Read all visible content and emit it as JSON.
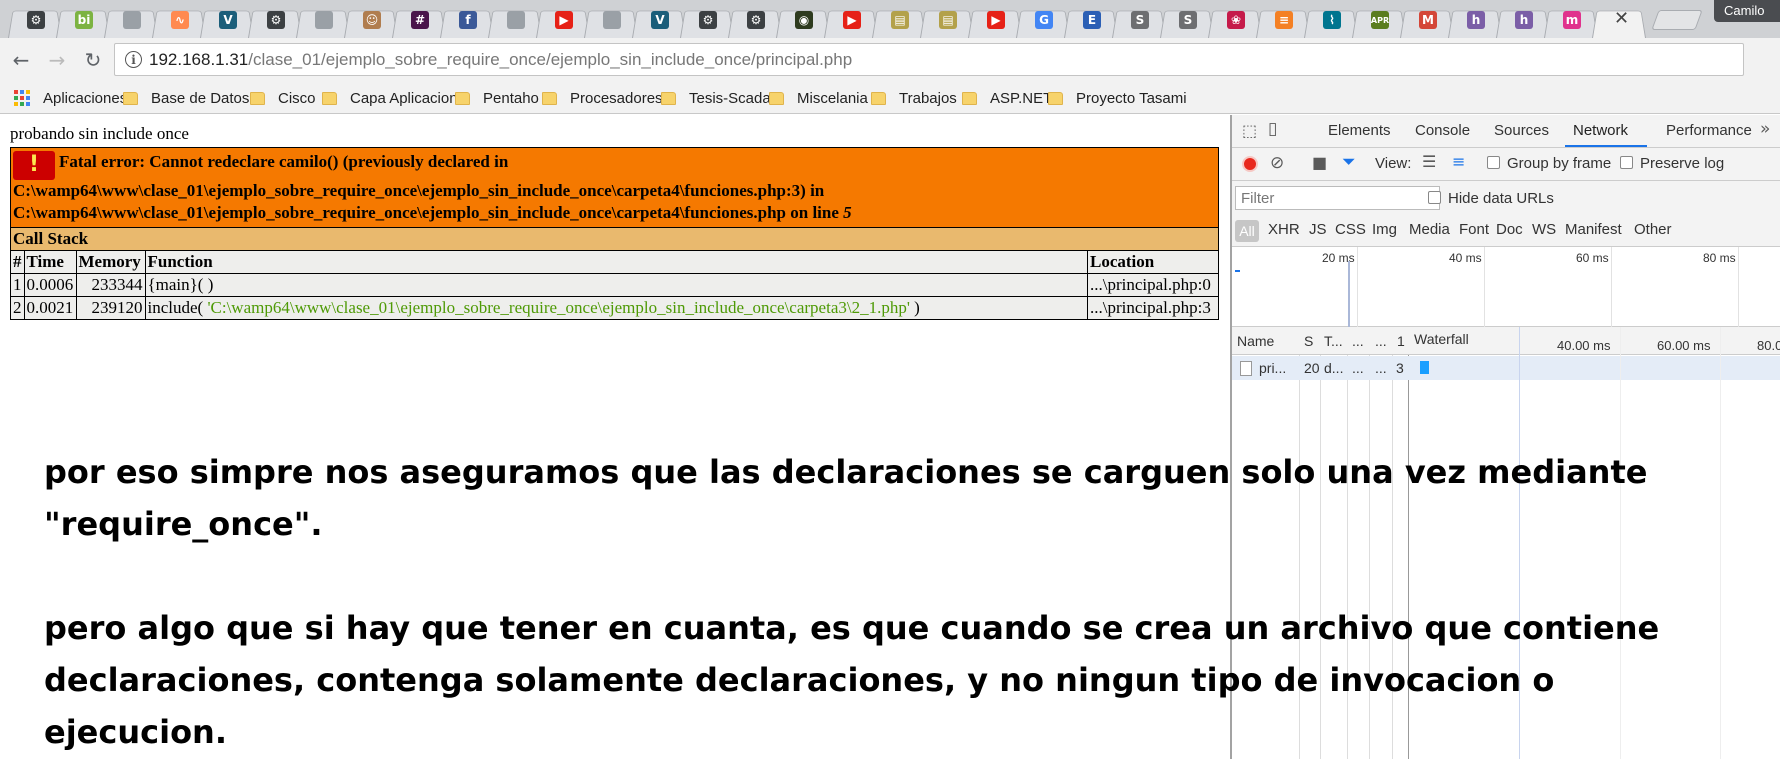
{
  "browser": {
    "tabs": [
      {
        "icon": "gear-icon",
        "color": "#3c4043",
        "glyph": "⚙"
      },
      {
        "icon": "bi-logo-icon",
        "color": "#7cb342",
        "glyph": "bi"
      },
      {
        "icon": "page-icon",
        "color": "#9aa0a6",
        "glyph": ""
      },
      {
        "icon": "wave-logo-icon",
        "color": "#ff8a50",
        "glyph": "∿"
      },
      {
        "icon": "v-logo-icon",
        "color": "#1b5e7a",
        "glyph": "V"
      },
      {
        "icon": "gear-icon",
        "color": "#3c4043",
        "glyph": "⚙"
      },
      {
        "icon": "page-icon",
        "color": "#9aa0a6",
        "glyph": ""
      },
      {
        "icon": "face-avatar-icon",
        "color": "#b07d4f",
        "glyph": "☺"
      },
      {
        "icon": "slack-icon",
        "color": "#4a154b",
        "glyph": "#"
      },
      {
        "icon": "facebook-icon",
        "color": "#3b5998",
        "glyph": "f"
      },
      {
        "icon": "page-icon",
        "color": "#9aa0a6",
        "glyph": ""
      },
      {
        "icon": "youtube-icon",
        "color": "#e62117",
        "glyph": "▶"
      },
      {
        "icon": "page-icon",
        "color": "#9aa0a6",
        "glyph": ""
      },
      {
        "icon": "v-logo-icon",
        "color": "#1b5e7a",
        "glyph": "V"
      },
      {
        "icon": "gear-icon",
        "color": "#3c4043",
        "glyph": "⚙"
      },
      {
        "icon": "gear-icon",
        "color": "#3c4043",
        "glyph": "⚙"
      },
      {
        "icon": "circle-logo-icon",
        "color": "#2e3b1f",
        "glyph": "◉"
      },
      {
        "icon": "youtube-icon",
        "color": "#e62117",
        "glyph": "▶"
      },
      {
        "icon": "doc-icon",
        "color": "#b3a14a",
        "glyph": "▤"
      },
      {
        "icon": "doc-icon",
        "color": "#b3a14a",
        "glyph": "▤"
      },
      {
        "icon": "youtube-icon",
        "color": "#e62117",
        "glyph": "▶"
      },
      {
        "icon": "translate-icon",
        "color": "#4285f4",
        "glyph": "G"
      },
      {
        "icon": "e-logo-icon",
        "color": "#2b5fb5",
        "glyph": "E"
      },
      {
        "icon": "s-logo-icon",
        "color": "#6d6e71",
        "glyph": "S"
      },
      {
        "icon": "s-logo-icon",
        "color": "#6d6e71",
        "glyph": "S"
      },
      {
        "icon": "raspberry-icon",
        "color": "#c51a4a",
        "glyph": "❀"
      },
      {
        "icon": "stackoverflow-icon",
        "color": "#f48024",
        "glyph": "≡"
      },
      {
        "icon": "mysql-icon",
        "color": "#00758f",
        "glyph": "⌇"
      },
      {
        "icon": "apr-logo-icon",
        "color": "#5a7d1e",
        "glyph": "APR"
      },
      {
        "icon": "gmail-icon",
        "color": "#d44638",
        "glyph": "M"
      },
      {
        "icon": "h-logo-icon",
        "color": "#7b5ea7",
        "glyph": "h"
      },
      {
        "icon": "h-logo-icon",
        "color": "#7b5ea7",
        "glyph": "h"
      },
      {
        "icon": "m-logo-icon",
        "color": "#e0338d",
        "glyph": "m"
      }
    ],
    "active_tab_close": "✕",
    "profile_name": "Camilo",
    "url_host": "192.168.1.31",
    "url_path": "/clase_01/ejemplo_sobre_require_once/ejemplo_sin_include_once/principal.php",
    "bookmarks": {
      "apps": "Aplicaciones",
      "folders": [
        "Base de Datos",
        "Cisco",
        "Capa Aplicacion",
        "Pentaho",
        "Procesadores",
        "Tesis-Scada",
        "Miscelania",
        "Trabajos",
        "ASP.NET",
        "Proyecto Tasami"
      ]
    }
  },
  "page": {
    "heading": "probando sin include once",
    "error": {
      "badge": "!",
      "line1": "Fatal error: Cannot redeclare camilo() (previously declared in",
      "line2": "C:\\wamp64\\www\\clase_01\\ejemplo_sobre_require_once\\ejemplo_sin_include_once\\carpeta4\\funciones.php:3) in",
      "line3": "C:\\wamp64\\www\\clase_01\\ejemplo_sobre_require_once\\ejemplo_sin_include_once\\carpeta4\\funciones.php on line ",
      "line_number": "5"
    },
    "call_stack": {
      "title": "Call Stack",
      "headers": [
        "#",
        "Time",
        "Memory",
        "Function",
        "Location"
      ],
      "rows": [
        {
          "n": "1",
          "time": "0.0006",
          "memory": "233344",
          "func": "{main}( )",
          "arg": "",
          "func_end": "",
          "location": "...\\principal.php:0"
        },
        {
          "n": "2",
          "time": "0.0021",
          "memory": "239120",
          "func": "include( ",
          "arg": "'C:\\wamp64\\www\\clase_01\\ejemplo_sobre_require_once\\ejemplo_sin_include_once\\carpeta3\\2_1.php'",
          "func_end": " )",
          "location": "...\\principal.php:3"
        }
      ]
    }
  },
  "devtools": {
    "tabs": [
      "Elements",
      "Console",
      "Sources",
      "Network",
      "Performance"
    ],
    "selected_tab": "Network",
    "toolbar": {
      "view_label": "View:",
      "group_by_frame": "Group by frame",
      "preserve_log": "Preserve log"
    },
    "filter_placeholder": "Filter",
    "hide_data_urls": "Hide data URLs",
    "types": [
      "All",
      "XHR",
      "JS",
      "CSS",
      "Img",
      "Media",
      "Font",
      "Doc",
      "WS",
      "Manifest",
      "Other"
    ],
    "overview_ticks": [
      "20 ms",
      "40 ms",
      "60 ms",
      "80 ms"
    ],
    "grid_headers": [
      "Name",
      "S",
      "T...",
      "...",
      "...",
      "1",
      "Waterfall",
      "40.00 ms",
      "60.00 ms",
      "80.0"
    ],
    "grid_row": [
      "pri...",
      "20",
      "d...",
      "...",
      "...",
      "3"
    ]
  },
  "annotation": {
    "para1_line1": "por eso simpre nos aseguramos que las declaraciones se carguen solo una vez mediante",
    "para1_line2": "\"require_once\".",
    "para2_line1": "pero algo que si hay que tener en cuanta, es que cuando se crea un archivo que contiene",
    "para2_line2": "declaraciones, contenga solamente declaraciones, y no ningun tipo de invocacion o ejecucion."
  }
}
